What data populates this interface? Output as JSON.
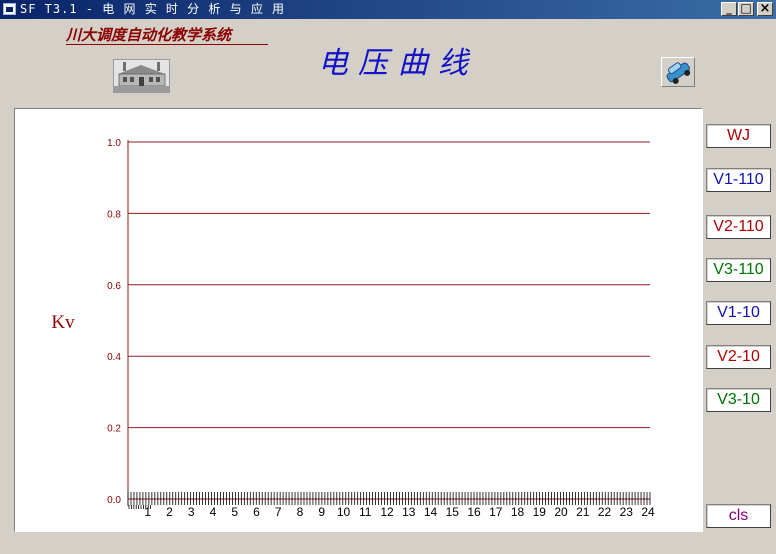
{
  "window": {
    "title": "SF T3.1 - 电 网 实 时 分 析 与 应 用",
    "controls": {
      "minimize": "_",
      "maximize": "□",
      "close": "×"
    }
  },
  "header": {
    "subtitle": "川大调度自动化教学系统",
    "title": "电压曲线",
    "left_icon": "power-station-icon",
    "right_icon": "car-icon"
  },
  "sidebar": {
    "buttons": [
      {
        "label": "WJ",
        "color": "#b00000"
      },
      {
        "label": "V1-110",
        "color": "#1010b0"
      },
      {
        "label": "V2-110",
        "color": "#b00000"
      },
      {
        "label": "V3-110",
        "color": "#007000"
      },
      {
        "label": "V1-10",
        "color": "#1010b0"
      },
      {
        "label": "V2-10",
        "color": "#b00000"
      },
      {
        "label": "V3-10",
        "color": "#007000"
      }
    ],
    "cls_button": {
      "label": "cls",
      "color": "#800080"
    }
  },
  "colors": {
    "grid": "#8b1a1a",
    "axis_text": "#8b0000",
    "tick": "#000000"
  },
  "chart_data": {
    "type": "line",
    "title": "",
    "xlabel": "",
    "ylabel": "Kv",
    "xlim": [
      0,
      24
    ],
    "ylim": [
      0.0,
      1.0
    ],
    "x_ticks": [
      "1",
      "2",
      "3",
      "4",
      "5",
      "6",
      "7",
      "8",
      "9",
      "10",
      "11",
      "12",
      "13",
      "14",
      "15",
      "16",
      "17",
      "18",
      "19",
      "20",
      "21",
      "22",
      "23",
      "24"
    ],
    "y_ticks": [
      "0.0",
      "0.2",
      "0.4",
      "0.6",
      "0.8",
      "1.0"
    ],
    "grid": true,
    "series": []
  }
}
